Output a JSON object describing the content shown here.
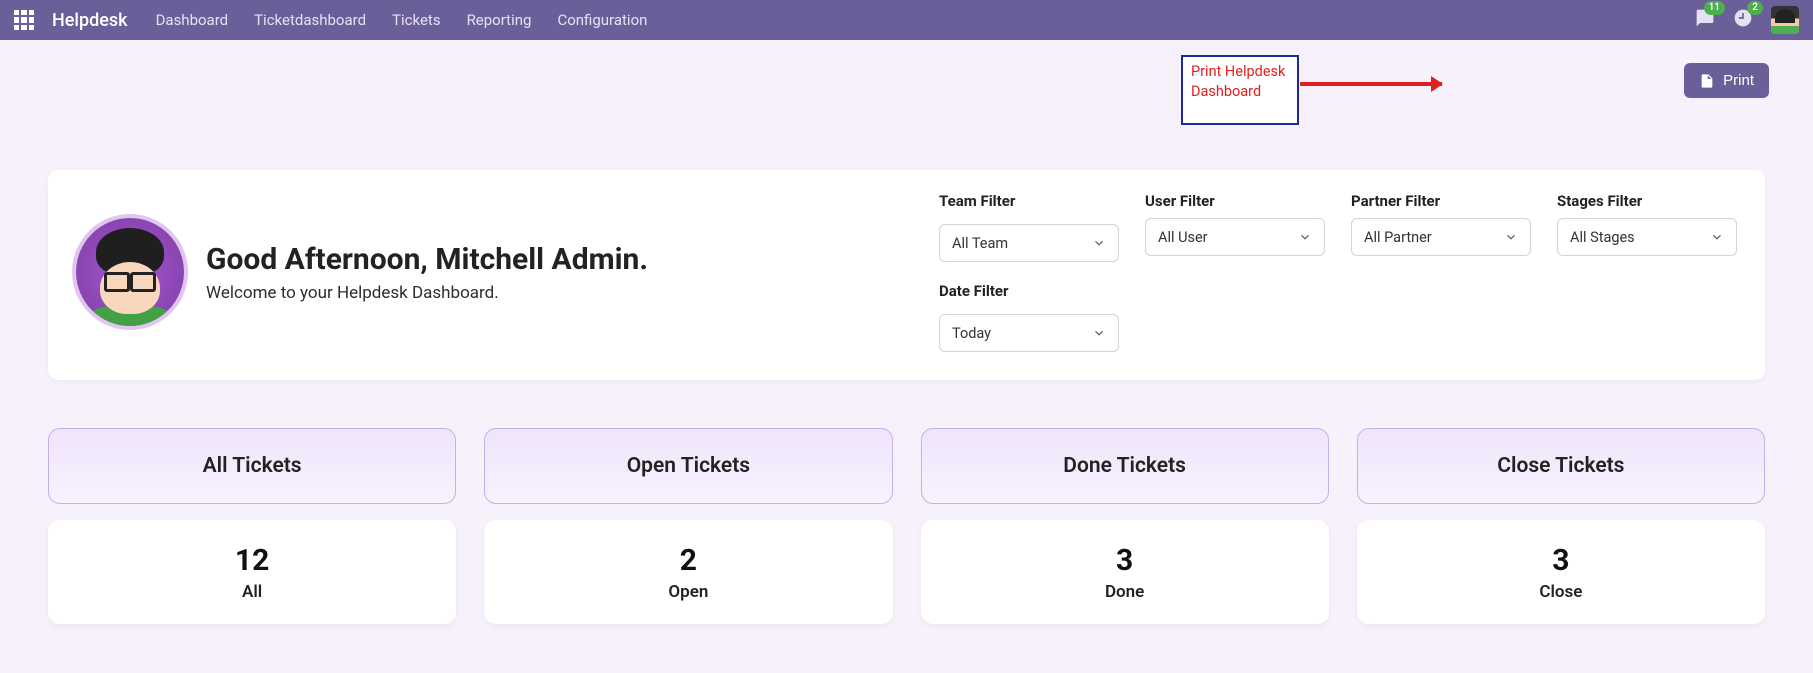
{
  "nav": {
    "brand": "Helpdesk",
    "links": [
      "Dashboard",
      "Ticketdashboard",
      "Tickets",
      "Reporting",
      "Configuration"
    ],
    "messages_badge": "11",
    "activity_badge": "2"
  },
  "callout": {
    "text": "Print Helpdesk Dashboard"
  },
  "print_button": {
    "label": "Print"
  },
  "greeting": {
    "title": "Good Afternoon, Mitchell Admin.",
    "subtitle": "Welcome to your Helpdesk Dashboard."
  },
  "filters": {
    "team": {
      "label": "Team Filter",
      "value": "All Team"
    },
    "user": {
      "label": "User Filter",
      "value": "All User"
    },
    "partner": {
      "label": "Partner Filter",
      "value": "All Partner"
    },
    "stages": {
      "label": "Stages Filter",
      "value": "All Stages"
    },
    "date": {
      "label": "Date Filter",
      "value": "Today"
    }
  },
  "stats": [
    {
      "title": "All Tickets",
      "value": "12",
      "label": "All"
    },
    {
      "title": "Open Tickets",
      "value": "2",
      "label": "Open"
    },
    {
      "title": "Done Tickets",
      "value": "3",
      "label": "Done"
    },
    {
      "title": "Close Tickets",
      "value": "3",
      "label": "Close"
    }
  ]
}
